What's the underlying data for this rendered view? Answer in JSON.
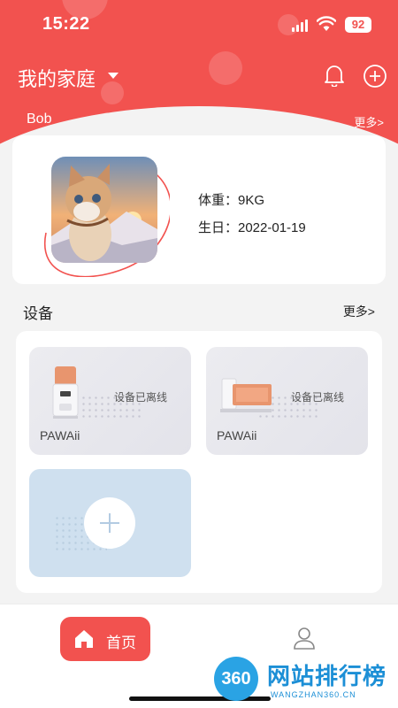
{
  "status_bar": {
    "time": "15:22",
    "battery": "92"
  },
  "header": {
    "family_title": "我的家庭"
  },
  "pet_section": {
    "active_pet": "Bob",
    "more_label": "更多>"
  },
  "pet": {
    "weight": "体重：9KG",
    "birthday": "生日：2022-01-19"
  },
  "devices_section": {
    "title": "设备",
    "more_label": "更多>",
    "devices": [
      {
        "name": "PAWAii",
        "status": "设备已离线"
      },
      {
        "name": "PAWAii",
        "status": "设备已离线"
      }
    ]
  },
  "bottom_nav": {
    "home_label": "首页"
  },
  "watermark": {
    "title": "网站排行榜",
    "logo": "360",
    "url": "WANGZHAN360.CN"
  },
  "colors": {
    "accent": "#f2524f",
    "card_bg": "#ffffff",
    "page_bg": "#f3f3f3",
    "add_card_bg": "#cfe0ef"
  }
}
